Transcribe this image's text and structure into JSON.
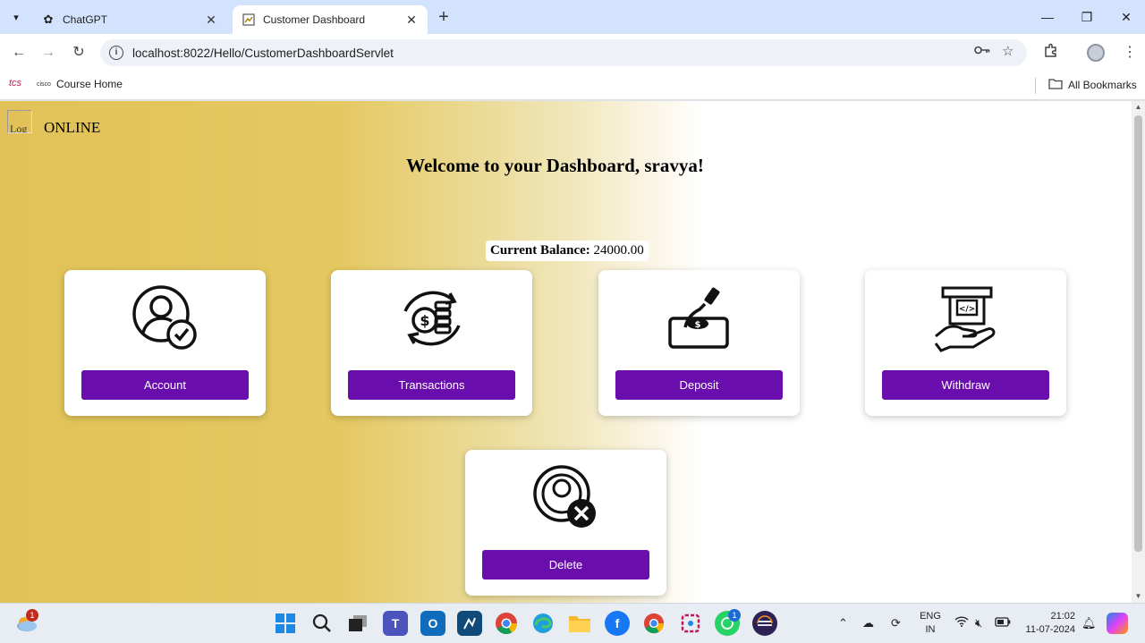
{
  "browser": {
    "tabs": [
      {
        "title": "ChatGPT",
        "active": false
      },
      {
        "title": "Customer Dashboard",
        "active": true
      }
    ],
    "url": "localhost:8022/Hello/CustomerDashboardServlet",
    "bookmarks": {
      "course_home": "Course Home",
      "tcs_label": "tcs",
      "cisco_label": "cisco",
      "all_bookmarks": "All Bookmarks"
    }
  },
  "page": {
    "logo_alt": "Log",
    "brand": "ONLINE",
    "welcome": "Welcome to your Dashboard, sravya!",
    "balance_label": "Current Balance:",
    "balance_value": "24000.00",
    "accent_color": "#6a0dad",
    "cards": [
      {
        "label": "Account",
        "icon": "user-check-icon"
      },
      {
        "label": "Transactions",
        "icon": "money-cycle-icon"
      },
      {
        "label": "Deposit",
        "icon": "deposit-hand-icon"
      },
      {
        "label": "Withdraw",
        "icon": "atm-withdraw-icon"
      },
      {
        "label": "Delete",
        "icon": "user-delete-icon"
      }
    ]
  },
  "taskbar": {
    "weather_badge": "1",
    "whatsapp_badge": "1",
    "lang_top": "ENG",
    "lang_bottom": "IN",
    "time": "21:02",
    "date": "11-07-2024"
  }
}
